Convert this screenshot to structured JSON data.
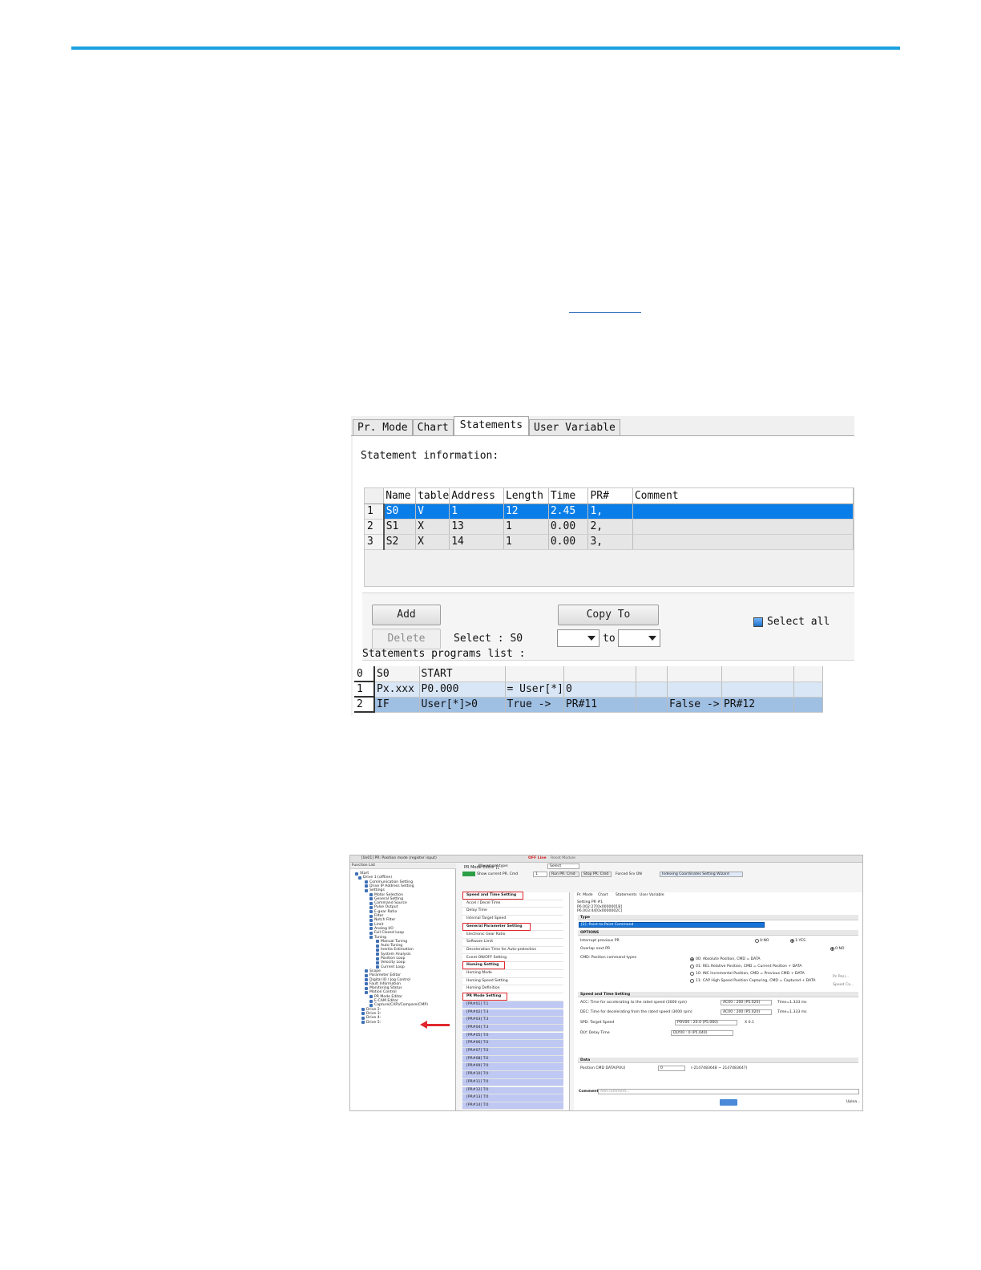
{
  "statements_panel": {
    "tabs": [
      "Pr. Mode",
      "Chart",
      "Statements",
      "User Variable"
    ],
    "active_tab": "Statements",
    "info_label": "Statement information:",
    "columns": [
      "Name",
      "table",
      "Address",
      "Length",
      "Time",
      "PR#",
      "Comment"
    ],
    "rows": [
      {
        "index": "1",
        "name": "S0",
        "table": "V",
        "address": "1",
        "length": "12",
        "time": "2.45",
        "pr": "1,",
        "comment": ""
      },
      {
        "index": "2",
        "name": "S1",
        "table": "X",
        "address": "13",
        "length": "1",
        "time": "0.00",
        "pr": "2,",
        "comment": ""
      },
      {
        "index": "3",
        "name": "S2",
        "table": "X",
        "address": "14",
        "length": "1",
        "time": "0.00",
        "pr": "3,",
        "comment": ""
      }
    ],
    "selected_row": "1",
    "add_label": "Add",
    "delete_label": "Delete",
    "select_text": "Select : S0",
    "copy_to_label": "Copy To",
    "to_label": "to",
    "select_all_label": "Select all",
    "programs_label": "Statements programs list :",
    "program_rows": [
      {
        "index": "0",
        "c1": "S0",
        "c2": "START",
        "c3": "",
        "c4": "",
        "c5": "",
        "c6": "",
        "c7": "",
        "c8": ""
      },
      {
        "index": "1",
        "c1": "Px.xxx",
        "c2": "P0.000",
        "c3": "= User[*]",
        "c4": "0",
        "c5": "",
        "c6": "",
        "c7": "",
        "c8": ""
      },
      {
        "index": "2",
        "c1": "IF",
        "c2": "User[*]>0",
        "c3": "True ->",
        "c4": "PR#11",
        "c5": "",
        "c6": "False ->",
        "c7": "PR#12",
        "c8": ""
      }
    ],
    "colors": {
      "selection": "#0a7ee8",
      "row_highlight": "#9fbfe3"
    }
  },
  "pr_editor": {
    "top_bar": {
      "title": "[0x01] PR: Position mode (register input)",
      "status": "OFF Line",
      "reset": "Reset Module"
    },
    "function_list": {
      "header": "Function List",
      "items": [
        "Start",
        "Drive 1:(offline)",
        "Communication Setting",
        "Drive IP Address Setting",
        "Settings",
        "Motor Selection",
        "General Setting",
        "Command Source",
        "Pulse Output",
        "E-gear Ratio",
        "Filter",
        "Notch Filter",
        "Limit",
        "Analog I/O",
        "Full Closed Loop",
        "Tuning",
        "Manual Tuning",
        "Auto Tuning",
        "Inertia Estimation",
        "System Analysis",
        "Position Loop",
        "Velocity Loop",
        "Current Loop",
        "Scope",
        "Parameter Editor",
        "Digital IO / Jog Control",
        "Fault Information",
        "Monitoring Status",
        "Motion Control",
        "PR Mode Editor",
        "E-CAM Editor",
        "Capture(CAP)/Compare(CMP)",
        "Drive 2:",
        "Drive 3:",
        "Drive 4:",
        "Drive 5:"
      ]
    },
    "window_title": "PR Mode Editor []",
    "toolbar": {
      "show_current": "Show current PR. Cmd",
      "movement_type": "Movement type:",
      "movement_value": "Select",
      "run_pr": "Run PR. Cmd",
      "stop_pr": "Stop PR. Cmd",
      "forced_srv": "Forced Srv ON",
      "wizard": "Indexing Coordinates Setting Wizard",
      "pr_value": "1"
    },
    "list": [
      {
        "label": "Speed and Time Setting",
        "head": true,
        "boxed": true
      },
      {
        "label": "Accel / Decel Time"
      },
      {
        "label": "Delay Time"
      },
      {
        "label": "Internal Target Speed"
      },
      {
        "label": "General Parameter Setting",
        "head": true,
        "boxed": true
      },
      {
        "label": "Electronic Gear Ratio"
      },
      {
        "label": "Software Limit"
      },
      {
        "label": "Deceleration Time for Auto-protection"
      },
      {
        "label": "Event ON/OFF Setting"
      },
      {
        "label": "Homing Setting",
        "head": true,
        "boxed": true
      },
      {
        "label": "Homing Mode"
      },
      {
        "label": "Homing Speed Setting"
      },
      {
        "label": "Homing Definition"
      },
      {
        "label": "PR Mode Setting",
        "head": true,
        "boxed": true
      },
      {
        "label": "[PR#01] T:1",
        "pr": true
      },
      {
        "label": "[PR#02] T:3",
        "pr": true
      },
      {
        "label": "[PR#03] T:3",
        "pr": true
      },
      {
        "label": "[PR#04] T:3",
        "pr": true
      },
      {
        "label": "[PR#05] T:0",
        "pr": true
      },
      {
        "label": "[PR#06] T:0",
        "pr": true
      },
      {
        "label": "[PR#07] T:0",
        "pr": true
      },
      {
        "label": "[PR#08] T:0",
        "pr": true
      },
      {
        "label": "[PR#09] T:0",
        "pr": true
      },
      {
        "label": "[PR#10] T:0",
        "pr": true
      },
      {
        "label": "[PR#11] T:0",
        "pr": true
      },
      {
        "label": "[PR#12] T:0",
        "pr": true
      },
      {
        "label": "[PR#13] T:0",
        "pr": true
      },
      {
        "label": "[PR#14] T:0",
        "pr": true
      }
    ],
    "right_tabs": [
      "Pr. Mode",
      "Chart",
      "Statements",
      "User Variable"
    ],
    "setting": {
      "title": "Setting PR #1",
      "line1": "P6.002:27[0x0000001B]",
      "line2": "P6.003:44[0x0000002C]"
    },
    "type_label": "Type",
    "type_value": "[2] :Point-to-Point Command",
    "options_label": "OPTIONS",
    "interrupt_label": "Interrupt previous PR",
    "interrupt_no": "0:NO",
    "interrupt_yes": "1:YES",
    "overlap_label": "Overlap next PR",
    "overlap_no": "0:NO",
    "cmd_types_label": "CMD: Position command types",
    "cmd_options": [
      "00: Absolute Position, CMD = DATA",
      "01: REL Relative Position, CMD = Current Position + DATA",
      "10: INC Incremental Position, CMD = Previous CMD + DATA",
      "11: CAP High Speed Position Capturing, CMD = Captured + DATA"
    ],
    "pc_label": "Pc Posi...",
    "speed_cap": "Speed Ca...",
    "speed_section": "Speed and Time Setting",
    "acc_label": "ACC: Time for accelerating to the rated speed (3000 rpm)",
    "acc_value": "AC00 : 200 (P5.020)",
    "acc_time": "Time=1.333 ms",
    "dec_label": "DEC: Time for decelerating from the rated speed (3000 rpm)",
    "dec_value": "AC00 : 200 (P5.020)",
    "dec_time": "Time=1.333 ms",
    "spd_label": "SPD: Target Speed",
    "spd_value": "POV00 : 20.0 (P5.060)",
    "spd_mult": "X 0.1",
    "dly_label": "DLY: Delay Time",
    "dly_value": "DLY00 : 0 (P5.040)",
    "data_section": "Data",
    "pos_label": "Position CMD DATA(PUU)",
    "pos_value": "0",
    "pos_range": "(-2147483648 ~ 2147483647)",
    "comment_label": "Comment:",
    "comment_placeholder": "Add comment...",
    "upload": "Uploa..."
  }
}
